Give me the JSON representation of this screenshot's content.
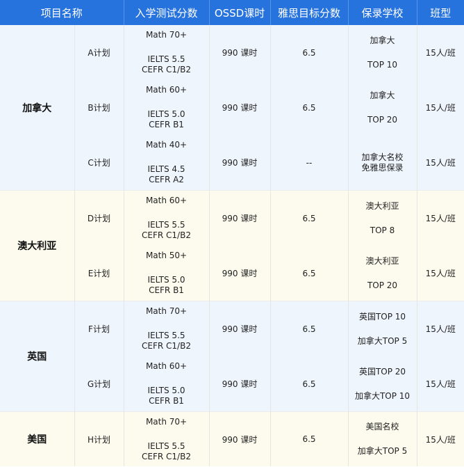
{
  "headers": [
    "项目名称",
    "入学测试分数",
    "OSSD课时",
    "雅思目标分数",
    "保录学校",
    "班型"
  ],
  "groups": [
    {
      "name": "加拿大",
      "rows": [
        {
          "plan": "A计划",
          "test": [
            "Math 70+",
            "IELTS 5.5",
            "CEFR C1/B2"
          ],
          "hours": "990 课时",
          "ielts_target": "6.5",
          "school": [
            "加拿大",
            "TOP 10"
          ],
          "class": "15人/班"
        },
        {
          "plan": "B计划",
          "test": [
            "Math 60+",
            "IELTS 5.0",
            "CEFR B1"
          ],
          "hours": "990 课时",
          "ielts_target": "6.5",
          "school": [
            "加拿大",
            "TOP 20"
          ],
          "class": "15人/班"
        },
        {
          "plan": "C计划",
          "test": [
            "Math 40+",
            "IELTS 4.5",
            "CEFR A2"
          ],
          "hours": "990 课时",
          "ielts_target": "--",
          "school": [
            "加拿大名校",
            "免雅思保录"
          ],
          "class": "15人/班"
        }
      ]
    },
    {
      "name": "澳大利亚",
      "rows": [
        {
          "plan": "D计划",
          "test": [
            "Math 60+",
            "IELTS 5.5",
            "CEFR C1/B2"
          ],
          "hours": "990 课时",
          "ielts_target": "6.5",
          "school": [
            "澳大利亚",
            "TOP 8"
          ],
          "class": "15人/班"
        },
        {
          "plan": "E计划",
          "test": [
            "Math 50+",
            "IELTS 5.0",
            "CEFR B1"
          ],
          "hours": "990 课时",
          "ielts_target": "6.5",
          "school": [
            "澳大利亚",
            "TOP 20"
          ],
          "class": "15人/班"
        }
      ]
    },
    {
      "name": "英国",
      "rows": [
        {
          "plan": "F计划",
          "test": [
            "Math 70+",
            "IELTS 5.5",
            "CEFR C1/B2"
          ],
          "hours": "990 课时",
          "ielts_target": "6.5",
          "school": [
            "英国TOP 10",
            "加拿大TOP 5"
          ],
          "class": "15人/班"
        },
        {
          "plan": "G计划",
          "test": [
            "Math 60+",
            "IELTS 5.0",
            "CEFR B1"
          ],
          "hours": "990 课时",
          "ielts_target": "6.5",
          "school": [
            "英国TOP 20",
            "加拿大TOP 10"
          ],
          "class": "15人/班"
        }
      ]
    },
    {
      "name": "美国",
      "rows": [
        {
          "plan": "H计划",
          "test": [
            "Math 70+",
            "IELTS 5.5",
            "CEFR C1/B2"
          ],
          "hours": "990 课时",
          "ielts_target": "6.5",
          "school": [
            "美国名校",
            "加拿大TOP 5"
          ],
          "class": "15人/班"
        }
      ]
    }
  ]
}
